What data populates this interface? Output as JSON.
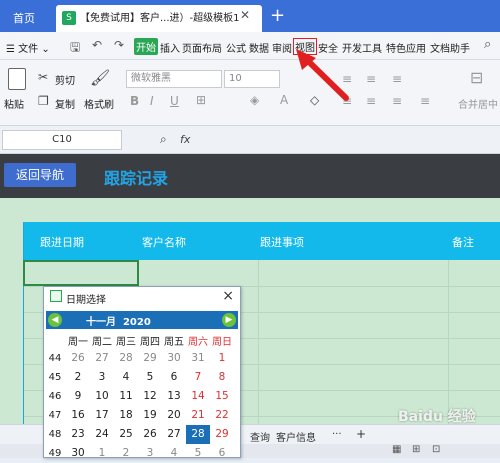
{
  "titlebar": {
    "home_tab": "首页",
    "doc_tab": "【免费试用】客户...进）-超级模板1",
    "doc_icon": "S",
    "new_tab": "+",
    "close": "✕"
  },
  "menubar": {
    "file_menu": "文件",
    "items": [
      "开始",
      "插入",
      "页面布局",
      "公式",
      "数据",
      "审阅",
      "视图",
      "安全",
      "开发工具",
      "特色应用",
      "文档助手"
    ],
    "active": "开始",
    "highlighted": "视图"
  },
  "ribbon": {
    "paste": "粘贴",
    "cut": "剪切",
    "copy": "复制",
    "format_painter": "格式刷",
    "font_name": "微软雅黑",
    "font_size": "10",
    "merge_center": "合并居中"
  },
  "formulabar": {
    "cell_ref": "C10",
    "fx": "fx"
  },
  "sheet": {
    "back_button": "返回导航",
    "title": "跟踪记录",
    "headers": [
      "跟进日期",
      "客户名称",
      "跟进事项",
      "备注"
    ]
  },
  "date_picker": {
    "title": "日期选择",
    "month": "十一月",
    "year": "2020",
    "weekdays": [
      "周一",
      "周二",
      "周三",
      "周四",
      "周五",
      "周六",
      "周日"
    ],
    "rows": [
      {
        "week": "44",
        "days": [
          "26",
          "27",
          "28",
          "29",
          "30",
          "31",
          "1"
        ]
      },
      {
        "week": "45",
        "days": [
          "2",
          "3",
          "4",
          "5",
          "6",
          "7",
          "8"
        ]
      },
      {
        "week": "46",
        "days": [
          "9",
          "10",
          "11",
          "12",
          "13",
          "14",
          "15"
        ]
      },
      {
        "week": "47",
        "days": [
          "16",
          "17",
          "18",
          "19",
          "20",
          "21",
          "22"
        ]
      },
      {
        "week": "48",
        "days": [
          "23",
          "24",
          "25",
          "26",
          "27",
          "28",
          "29"
        ]
      },
      {
        "week": "49",
        "days": [
          "30",
          "1",
          "2",
          "3",
          "4",
          "5",
          "6"
        ]
      }
    ],
    "selected_day": "28"
  },
  "sheettabs": {
    "tabs": [
      "查询",
      "客户信息"
    ],
    "more": "···",
    "add": "+"
  },
  "watermark": "Baidu 经验",
  "colors": {
    "title_bar": "#3a6fd8",
    "accent_green": "#2aa655",
    "header_cyan": "#13b9ea",
    "sheet_bg": "#cde8d2",
    "picker_blue": "#1a6fb6",
    "annotation_red": "#e02020"
  }
}
